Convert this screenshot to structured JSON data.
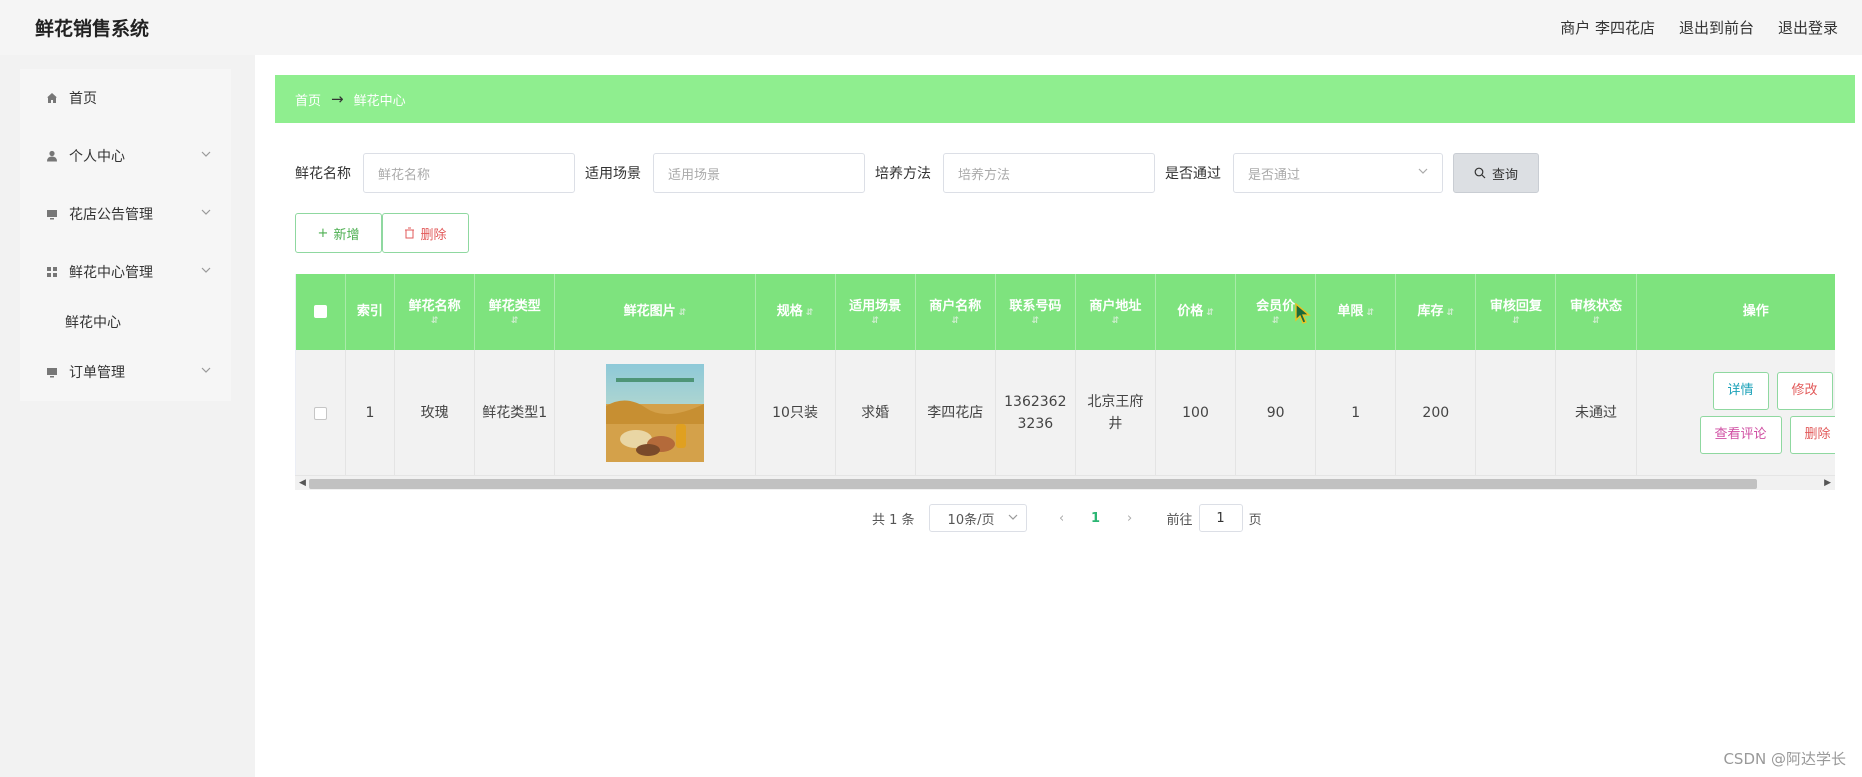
{
  "header": {
    "title": "鲜花销售系统",
    "merchant": "商户 李四花店",
    "to_front": "退出到前台",
    "logout": "退出登录"
  },
  "sidebar": {
    "items": [
      {
        "label": "首页",
        "icon": "home-icon"
      },
      {
        "label": "个人中心",
        "icon": "user-icon"
      },
      {
        "label": "花店公告管理",
        "icon": "monitor-icon"
      },
      {
        "label": "鲜花中心管理",
        "icon": "grid-icon"
      },
      {
        "label": "鲜花中心",
        "icon": ""
      },
      {
        "label": "订单管理",
        "icon": "monitor-icon"
      }
    ]
  },
  "breadcrumb": {
    "home": "首页",
    "arrow": "→",
    "current": "鲜花中心"
  },
  "search": {
    "name_label": "鲜花名称",
    "name_placeholder": "鲜花名称",
    "scene_label": "适用场景",
    "scene_placeholder": "适用场景",
    "method_label": "培养方法",
    "method_placeholder": "培养方法",
    "pass_label": "是否通过",
    "pass_placeholder": "是否通过",
    "query": "查询"
  },
  "actions": {
    "add": "新增",
    "delete": "删除"
  },
  "table": {
    "columns": [
      "索引",
      "鲜花名称",
      "鲜花类型",
      "鲜花图片",
      "规格",
      "适用场景",
      "商户名称",
      "联系号码",
      "商户地址",
      "价格",
      "会员价",
      "单限",
      "库存",
      "审核回复",
      "审核状态",
      "操作"
    ],
    "row": {
      "index": "1",
      "name": "玫瑰",
      "type": "鲜花类型1",
      "spec": "10只装",
      "scene": "求婚",
      "merchant": "李四花店",
      "phone": "13623623236",
      "address": "北京王府井",
      "price": "100",
      "member_price": "90",
      "limit": "1",
      "stock": "200",
      "reply": "",
      "status": "未通过"
    },
    "ops": {
      "detail": "详情",
      "edit": "修改",
      "review": "查看评论",
      "remove": "删除"
    }
  },
  "pager": {
    "total": "共 1 条",
    "size": "10条/页",
    "current": "1",
    "goto": "前往",
    "goto_value": "1",
    "page_unit": "页"
  },
  "watermark": "CSDN @阿达学长",
  "colors": {
    "accent_green": "#8fee8f",
    "header_green": "#7ee37e"
  }
}
